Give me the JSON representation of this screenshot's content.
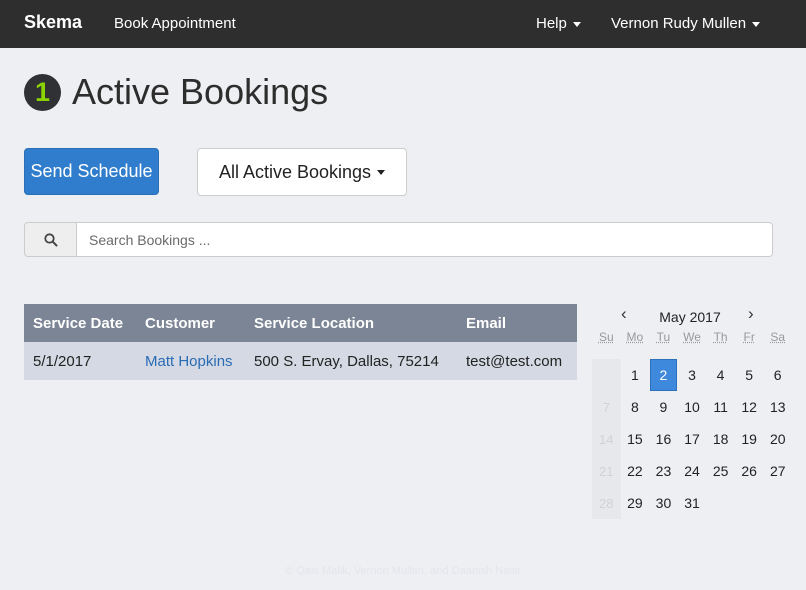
{
  "navbar": {
    "brand": "Skema",
    "book_appointment": "Book Appointment",
    "help": "Help",
    "user": "Vernon Rudy Mullen"
  },
  "header": {
    "count": "1",
    "title": "Active Bookings"
  },
  "toolbar": {
    "send_schedule": "Send Schedule",
    "filter": "All Active Bookings"
  },
  "search": {
    "placeholder": "Search Bookings ...",
    "value": ""
  },
  "table": {
    "headers": [
      "Service Date",
      "Customer",
      "Service Location",
      "Email"
    ],
    "rows": [
      {
        "date": "5/1/2017",
        "customer": "Matt Hopkins",
        "location": "500 S. Ervay, Dallas, 75214",
        "email": "test@test.com"
      }
    ]
  },
  "calendar": {
    "prev": "‹",
    "next": "›",
    "title": "May 2017",
    "days_of_week": [
      "Su",
      "Mo",
      "Tu",
      "We",
      "Th",
      "Fr",
      "Sa"
    ],
    "selected_day": "2",
    "weeks": [
      [
        "",
        "1",
        "2",
        "3",
        "4",
        "5",
        "6"
      ],
      [
        "7",
        "8",
        "9",
        "10",
        "11",
        "12",
        "13"
      ],
      [
        "14",
        "15",
        "16",
        "17",
        "18",
        "19",
        "20"
      ],
      [
        "21",
        "22",
        "23",
        "24",
        "25",
        "26",
        "27"
      ],
      [
        "28",
        "29",
        "30",
        "31",
        "",
        "",
        ""
      ]
    ]
  },
  "footer": {
    "text": "© Qais Malik, Vernon Mullen, and Daanish Nasir"
  },
  "colors": {
    "navbar": "#2e2e2e",
    "primary": "#2f7dcc",
    "badge_text": "#8bd400",
    "table_header": "#7b8596",
    "table_row": "#d4d9e3",
    "calendar_selected": "#3f89dc"
  },
  "icons": {
    "search": "search-icon"
  }
}
